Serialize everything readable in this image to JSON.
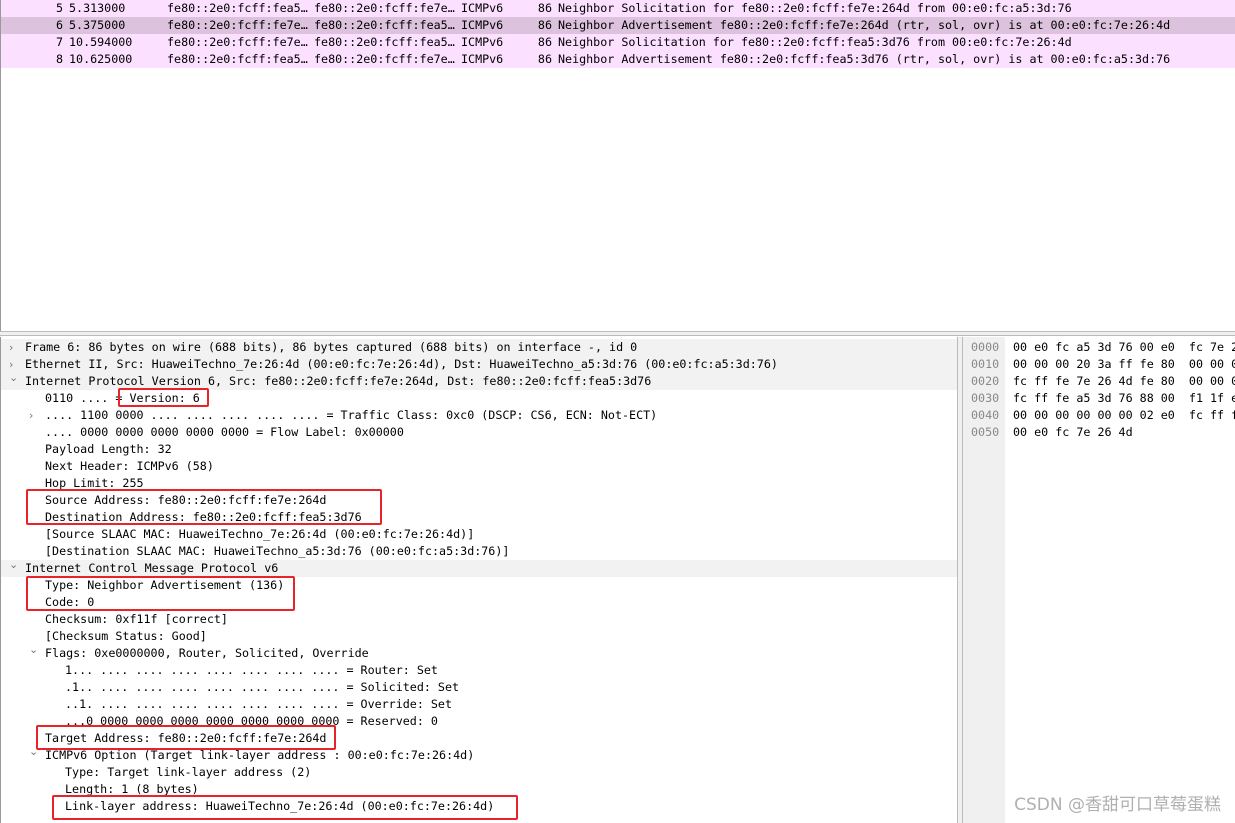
{
  "packets": [
    {
      "no": "5",
      "time": "5.313000",
      "src": "fe80::2e0:fcff:fea5…",
      "dst": "fe80::2e0:fcff:fe7e…",
      "proto": "ICMPv6",
      "len": "86",
      "info": "Neighbor Solicitation for fe80::2e0:fcff:fe7e:264d from 00:e0:fc:a5:3d:76"
    },
    {
      "no": "6",
      "time": "5.375000",
      "src": "fe80::2e0:fcff:fe7e…",
      "dst": "fe80::2e0:fcff:fea5…",
      "proto": "ICMPv6",
      "len": "86",
      "info": "Neighbor Advertisement fe80::2e0:fcff:fe7e:264d (rtr, sol, ovr) is at 00:e0:fc:7e:26:4d"
    },
    {
      "no": "7",
      "time": "10.594000",
      "src": "fe80::2e0:fcff:fe7e…",
      "dst": "fe80::2e0:fcff:fea5…",
      "proto": "ICMPv6",
      "len": "86",
      "info": "Neighbor Solicitation for fe80::2e0:fcff:fea5:3d76 from 00:e0:fc:7e:26:4d"
    },
    {
      "no": "8",
      "time": "10.625000",
      "src": "fe80::2e0:fcff:fea5…",
      "dst": "fe80::2e0:fcff:fe7e…",
      "proto": "ICMPv6",
      "len": "86",
      "info": "Neighbor Advertisement fe80::2e0:fcff:fea5:3d76 (rtr, sol, ovr) is at 00:e0:fc:a5:3d:76"
    }
  ],
  "selected_packet": "6",
  "colors": {
    "row": "#fce0ff",
    "selected": "#dcc2dc",
    "highlight": "#e8232a"
  },
  "tree": [
    {
      "text": "Frame 6: 86 bytes on wire (688 bits), 86 bytes captured (688 bits) on interface -, id 0",
      "level": 0,
      "arrow": "collapsed"
    },
    {
      "text": "Ethernet II, Src: HuaweiTechno_7e:26:4d (00:e0:fc:7e:26:4d), Dst: HuaweiTechno_a5:3d:76 (00:e0:fc:a5:3d:76)",
      "level": 0,
      "arrow": "collapsed"
    },
    {
      "text": "Internet Protocol Version 6, Src: fe80::2e0:fcff:fe7e:264d, Dst: fe80::2e0:fcff:fea5:3d76",
      "level": 0,
      "arrow": "expanded"
    },
    {
      "text": "0110 .... = Version: 6",
      "level": 1
    },
    {
      "text": ".... 1100 0000 .... .... .... .... .... = Traffic Class: 0xc0 (DSCP: CS6, ECN: Not-ECT)",
      "level": 1,
      "arrow": "collapsed"
    },
    {
      "text": ".... 0000 0000 0000 0000 0000 = Flow Label: 0x00000",
      "level": 1
    },
    {
      "text": "Payload Length: 32",
      "level": 1
    },
    {
      "text": "Next Header: ICMPv6 (58)",
      "level": 1
    },
    {
      "text": "Hop Limit: 255",
      "level": 1
    },
    {
      "text": "Source Address: fe80::2e0:fcff:fe7e:264d",
      "level": 1
    },
    {
      "text": "Destination Address: fe80::2e0:fcff:fea5:3d76",
      "level": 1
    },
    {
      "text": "[Source SLAAC MAC: HuaweiTechno_7e:26:4d (00:e0:fc:7e:26:4d)]",
      "level": 1
    },
    {
      "text": "[Destination SLAAC MAC: HuaweiTechno_a5:3d:76 (00:e0:fc:a5:3d:76)]",
      "level": 1
    },
    {
      "text": "Internet Control Message Protocol v6",
      "level": 0,
      "arrow": "expanded"
    },
    {
      "text": "Type: Neighbor Advertisement (136)",
      "level": 1
    },
    {
      "text": "Code: 0",
      "level": 1
    },
    {
      "text": "Checksum: 0xf11f [correct]",
      "level": 1
    },
    {
      "text": "[Checksum Status: Good]",
      "level": 1
    },
    {
      "text": "Flags: 0xe0000000, Router, Solicited, Override",
      "level": 1,
      "arrow": "expanded"
    },
    {
      "text": "1... .... .... .... .... .... .... .... = Router: Set",
      "level": 2
    },
    {
      "text": ".1.. .... .... .... .... .... .... .... = Solicited: Set",
      "level": 2
    },
    {
      "text": "..1. .... .... .... .... .... .... .... = Override: Set",
      "level": 2
    },
    {
      "text": "...0 0000 0000 0000 0000 0000 0000 0000 = Reserved: 0",
      "level": 2
    },
    {
      "text": "Target Address: fe80::2e0:fcff:fe7e:264d",
      "level": 1
    },
    {
      "text": "ICMPv6 Option (Target link-layer address : 00:e0:fc:7e:26:4d)",
      "level": 1,
      "arrow": "expanded"
    },
    {
      "text": "Type: Target link-layer address (2)",
      "level": 2
    },
    {
      "text": "Length: 1 (8 bytes)",
      "level": 2
    },
    {
      "text": "Link-layer address: HuaweiTechno_7e:26:4d (00:e0:fc:7e:26:4d)",
      "level": 2
    }
  ],
  "bytes": [
    {
      "offset": "0000",
      "hex": "00 e0 fc a5 3d 76 00 e0  fc 7e 2"
    },
    {
      "offset": "0010",
      "hex": "00 00 00 20 3a ff fe 80  00 00 0"
    },
    {
      "offset": "0020",
      "hex": "fc ff fe 7e 26 4d fe 80  00 00 0"
    },
    {
      "offset": "0030",
      "hex": "fc ff fe a5 3d 76 88 00  f1 1f e"
    },
    {
      "offset": "0040",
      "hex": "00 00 00 00 00 00 02 e0  fc ff f"
    },
    {
      "offset": "0050",
      "hex": "00 e0 fc 7e 26 4d"
    }
  ],
  "watermark": "CSDN @香甜可口草莓蛋糕"
}
